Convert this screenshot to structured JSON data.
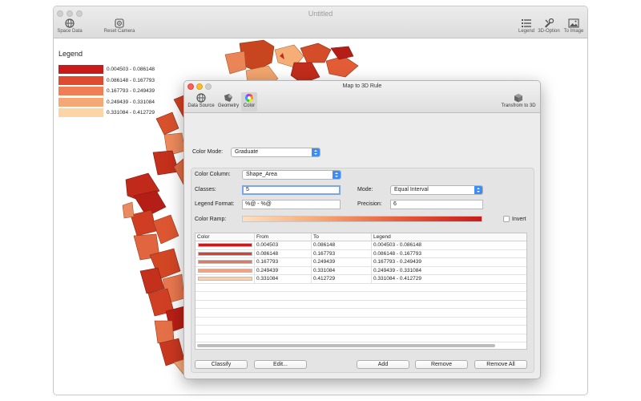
{
  "window": {
    "title": "Untitled",
    "toolbar_left": [
      {
        "label": "Space Data",
        "icon": "globe-icon"
      },
      {
        "label": "Reset Camera",
        "icon": "camera-target-icon"
      }
    ],
    "toolbar_right": [
      {
        "label": "Legend",
        "icon": "list-icon"
      },
      {
        "label": "3D-Option",
        "icon": "tools-icon"
      },
      {
        "label": "To Image",
        "icon": "image-icon"
      }
    ]
  },
  "legend": {
    "title": "Legend",
    "items": [
      {
        "label": "0.004503 - 0.086148",
        "color": "#c81b1b"
      },
      {
        "label": "0.086148 - 0.167793",
        "color": "#e04a2f"
      },
      {
        "label": "0.167793 - 0.249439",
        "color": "#ef7e55"
      },
      {
        "label": "0.249439 - 0.331084",
        "color": "#f5a775"
      },
      {
        "label": "0.331084 - 0.412729",
        "color": "#fdd4a3"
      }
    ]
  },
  "dialog": {
    "title": "Map to 3D Rule",
    "tabs": [
      {
        "label": "Data Source",
        "icon": "globe-icon"
      },
      {
        "label": "Geometry",
        "icon": "shapes-icon"
      },
      {
        "label": "Color",
        "icon": "color-wheel-icon"
      }
    ],
    "active_tab": "Color",
    "transform_label": "Transfrom to 3D",
    "color_mode_label": "Color Mode:",
    "color_mode_value": "Graduate",
    "color_column_label": "Color Column:",
    "color_column_value": "Shape_Area",
    "classes_label": "Classes:",
    "classes_value": "5",
    "mode_label": "Mode:",
    "mode_value": "Equal Interval",
    "legend_format_label": "Legend Format:",
    "legend_format_value": "%@ - %@",
    "precision_label": "Precision:",
    "precision_value": "6",
    "color_ramp_label": "Color Ramp:",
    "invert_label": "Invert",
    "table": {
      "columns": [
        "Color",
        "From",
        "To",
        "Legend"
      ],
      "rows": [
        {
          "color": "#c81b1b",
          "from": "0.004503",
          "to": "0.086148",
          "legend": "0.004503 - 0.086148"
        },
        {
          "color": "#d94030",
          "from": "0.086148",
          "to": "0.167793",
          "legend": "0.086148 - 0.167793"
        },
        {
          "color": "#e8765a",
          "from": "0.167793",
          "to": "0.249439",
          "legend": "0.167793 - 0.249439"
        },
        {
          "color": "#f0a382",
          "from": "0.249439",
          "to": "0.331084",
          "legend": "0.249439 - 0.331084"
        },
        {
          "color": "#f8d0b3",
          "from": "0.331084",
          "to": "0.412729",
          "legend": "0.331084 - 0.412729"
        }
      ]
    },
    "buttons": {
      "classify": "Classify",
      "edit": "Edit...",
      "add": "Add",
      "remove": "Remove",
      "remove_all": "Remove All"
    }
  }
}
